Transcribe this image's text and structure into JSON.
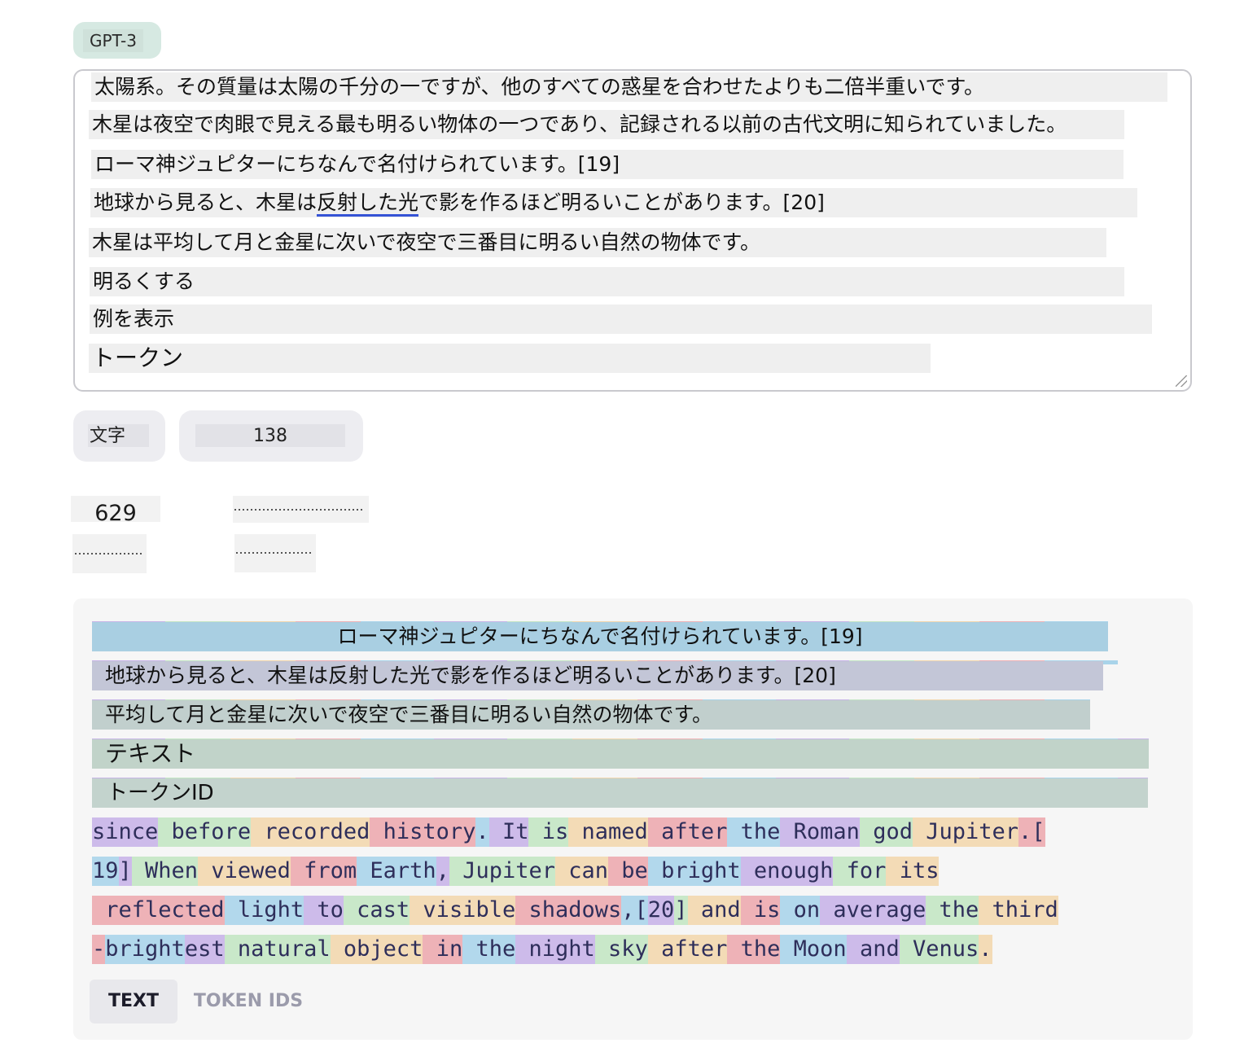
{
  "model_tab": {
    "label": "GPT-3"
  },
  "input_lines": [
    "太陽系。その質量は太陽の千分の一ですが、他のすべての惑星を合わせたよりも二倍半重いです。",
    "木星は夜空で肉眼で見える最も明るい物体の一つであり、記録される以前の古代文明に知られていました。",
    "ローマ神ジュピターにちなんで名付けられています。[19]",
    "地球から見ると、木星は",
    "反射した光",
    "で影を作るほど明るいことがあります。[20]",
    "木星は平均して月と金星に次いで夜空で三番目に明るい自然の物体です。",
    "明るくする",
    "例を表示",
    "トークン"
  ],
  "stats": {
    "chars_label": "文字",
    "chars_value": "138",
    "tokens_value": "629"
  },
  "token_panel": {
    "jp_rows": [
      "ローマ神ジュピターにちなんで名付けられています。[19]",
      "地球から見ると、木星は反射した光で影を作るほど明るいことがあります。[20]",
      "平均して月と金星に次いで夜空で三番目に明るい自然の物体です。",
      "テキスト",
      "トークンID"
    ],
    "tokens_line1": [
      "since",
      " before",
      " recorded",
      " history",
      ".",
      " It",
      " is",
      " named",
      " after",
      " the",
      " Roman",
      " god",
      " Jupiter",
      ".["
    ],
    "tokens_line2": [
      "19",
      "]",
      " When",
      " viewed",
      " from",
      " Earth",
      ",",
      " Jupiter",
      " can",
      " be",
      " bright",
      " enough",
      " for",
      " its"
    ],
    "tokens_line3": [
      " reflected",
      " light",
      " to",
      " cast",
      " visible",
      " shadows",
      ",[",
      "20",
      "]",
      " and",
      " is",
      " on",
      " average",
      " the",
      " third"
    ],
    "tokens_line4": [
      "-",
      "bright",
      "est",
      " natural",
      " object",
      " in",
      " the",
      " night",
      " sky",
      " after",
      " the",
      " Moon",
      " and",
      " Venus",
      "."
    ]
  },
  "view_tabs": {
    "text": "TEXT",
    "token_ids": "TOKEN IDS"
  },
  "colors": {
    "accent_underline": "#3553d6",
    "tab_bg": "#d6e9e2"
  }
}
